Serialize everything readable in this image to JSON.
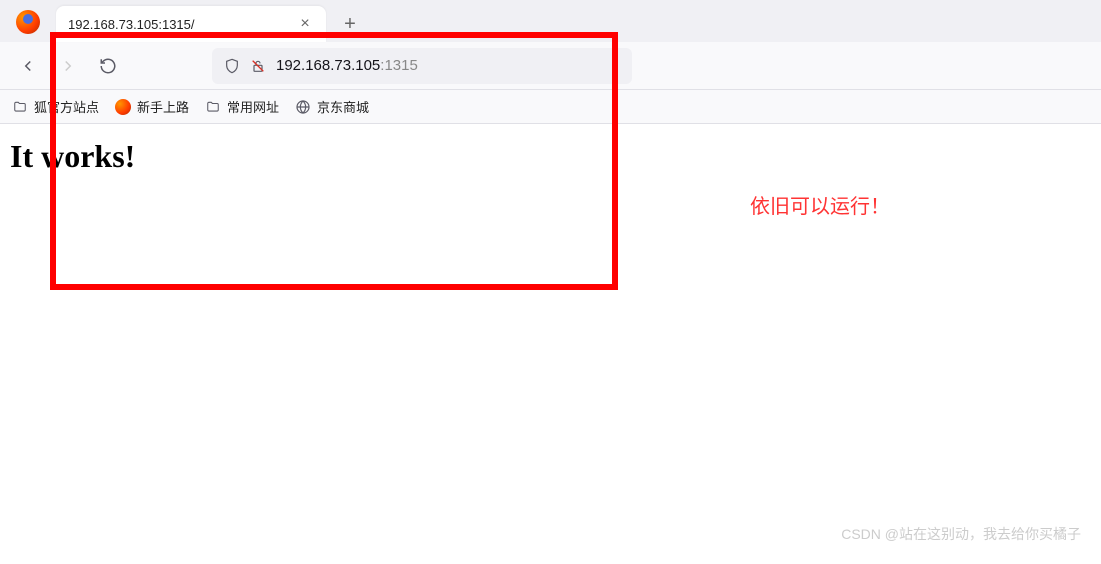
{
  "tab": {
    "title": "192.168.73.105:1315/"
  },
  "url": {
    "host": "192.168.73.105",
    "port": ":1315"
  },
  "bookmarks": [
    {
      "label": "狐官方站点",
      "icon": "folder"
    },
    {
      "label": "新手上路",
      "icon": "firefox"
    },
    {
      "label": "常用网址",
      "icon": "folder"
    },
    {
      "label": "京东商城",
      "icon": "globe"
    }
  ],
  "page": {
    "heading": "It works!"
  },
  "annotation": "依旧可以运行！",
  "watermark": "CSDN @站在这别动，我去给你买橘子",
  "colors": {
    "highlight": "#ff0000",
    "annotation_text": "#ff3333"
  }
}
